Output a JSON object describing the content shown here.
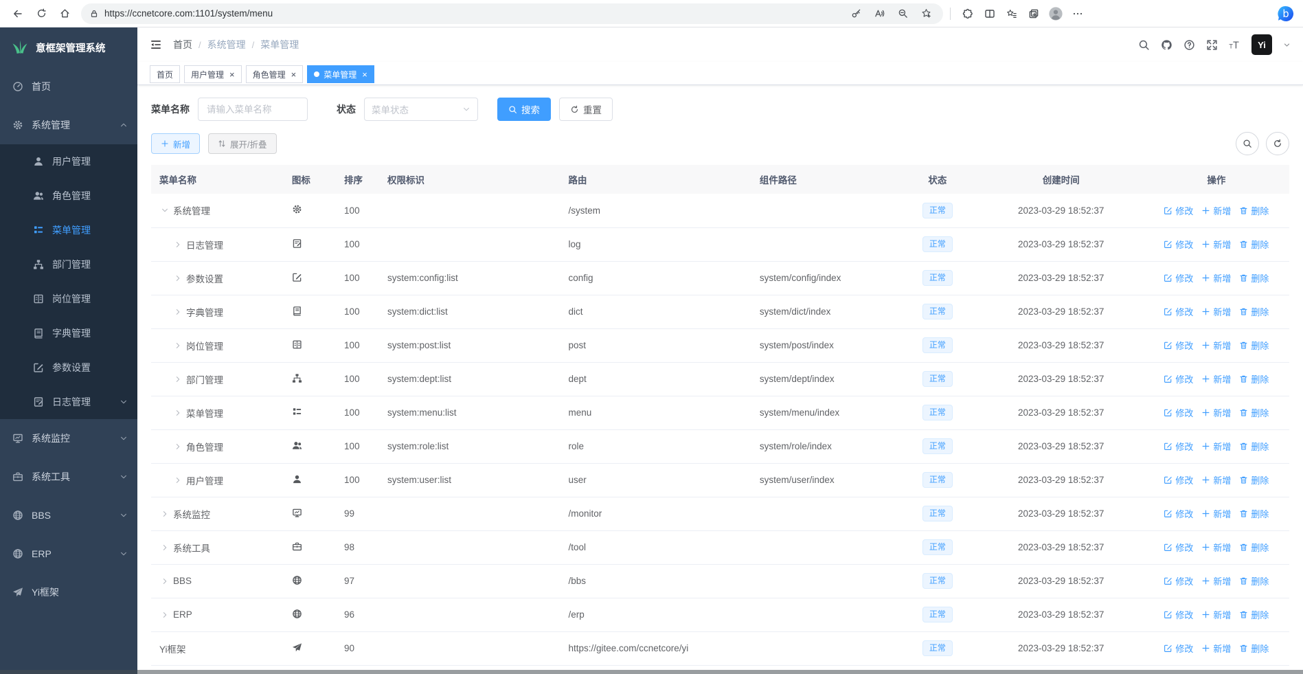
{
  "browser": {
    "url": "https://ccnetcore.com:1101/system/menu",
    "left_icons": [
      "back",
      "refresh",
      "home"
    ],
    "pill_icons": [
      "key",
      "read-aloud",
      "zoom-out",
      "add-favorite"
    ],
    "right_icons": [
      "extensions",
      "split-screen",
      "favorites",
      "collections",
      "profile",
      "more"
    ],
    "corner_icon": "copilot"
  },
  "sidebar": {
    "logo_title": "意框架管理系统",
    "items": [
      {
        "label": "首页",
        "icon": "dashboard"
      },
      {
        "label": "系统管理",
        "icon": "gear",
        "arrow": "up",
        "children": [
          {
            "label": "用户管理",
            "icon": "user"
          },
          {
            "label": "角色管理",
            "icon": "users"
          },
          {
            "label": "菜单管理",
            "icon": "menu-list",
            "active": true
          },
          {
            "label": "部门管理",
            "icon": "org-tree"
          },
          {
            "label": "岗位管理",
            "icon": "id-card"
          },
          {
            "label": "字典管理",
            "icon": "book"
          },
          {
            "label": "参数设置",
            "icon": "pen-square"
          },
          {
            "label": "日志管理",
            "icon": "doc-edit",
            "arrow": "down"
          }
        ]
      },
      {
        "label": "系统监控",
        "icon": "monitor",
        "arrow": "down"
      },
      {
        "label": "系统工具",
        "icon": "briefcase",
        "arrow": "down"
      },
      {
        "label": "BBS",
        "icon": "globe",
        "arrow": "down"
      },
      {
        "label": "ERP",
        "icon": "globe",
        "arrow": "down"
      },
      {
        "label": "Yi框架",
        "icon": "send"
      }
    ]
  },
  "navbar": {
    "breadcrumb": [
      "首页",
      "系统管理",
      "菜单管理"
    ],
    "icons": [
      "search",
      "github",
      "question",
      "fullscreen",
      "font-size"
    ],
    "avatar_text": "Yi"
  },
  "tabs": [
    {
      "label": "首页",
      "closable": false,
      "active": false
    },
    {
      "label": "用户管理",
      "closable": true,
      "active": false
    },
    {
      "label": "角色管理",
      "closable": true,
      "active": false
    },
    {
      "label": "菜单管理",
      "closable": true,
      "active": true
    }
  ],
  "filters": {
    "name_label": "菜单名称",
    "name_placeholder": "请输入菜单名称",
    "status_label": "状态",
    "status_placeholder": "菜单状态",
    "search_label": "搜索",
    "reset_label": "重置"
  },
  "toolbar": {
    "add_label": "新增",
    "expand_label": "展开/折叠"
  },
  "table": {
    "columns": [
      {
        "label": "菜单名称",
        "align": "left"
      },
      {
        "label": "图标",
        "align": "left"
      },
      {
        "label": "排序",
        "align": "left"
      },
      {
        "label": "权限标识",
        "align": "left"
      },
      {
        "label": "路由",
        "align": "left"
      },
      {
        "label": "组件路径",
        "align": "left"
      },
      {
        "label": "状态",
        "align": "center"
      },
      {
        "label": "创建时间",
        "align": "center"
      },
      {
        "label": "操作",
        "align": "center"
      }
    ],
    "action_labels": {
      "edit": "修改",
      "add": "新增",
      "delete": "删除"
    },
    "rows": [
      {
        "name": "系统管理",
        "icon": "gear",
        "sort": "100",
        "perms": "",
        "route": "/system",
        "component": "",
        "status": "正常",
        "created": "2023-03-29 18:52:37",
        "depth": 0,
        "expand": "expanded"
      },
      {
        "name": "日志管理",
        "icon": "doc-edit",
        "sort": "100",
        "perms": "",
        "route": "log",
        "component": "",
        "status": "正常",
        "created": "2023-03-29 18:52:37",
        "depth": 1,
        "expand": "collapsed"
      },
      {
        "name": "参数设置",
        "icon": "pen-square",
        "sort": "100",
        "perms": "system:config:list",
        "route": "config",
        "component": "system/config/index",
        "status": "正常",
        "created": "2023-03-29 18:52:37",
        "depth": 1,
        "expand": "collapsed"
      },
      {
        "name": "字典管理",
        "icon": "book",
        "sort": "100",
        "perms": "system:dict:list",
        "route": "dict",
        "component": "system/dict/index",
        "status": "正常",
        "created": "2023-03-29 18:52:37",
        "depth": 1,
        "expand": "collapsed"
      },
      {
        "name": "岗位管理",
        "icon": "id-card",
        "sort": "100",
        "perms": "system:post:list",
        "route": "post",
        "component": "system/post/index",
        "status": "正常",
        "created": "2023-03-29 18:52:37",
        "depth": 1,
        "expand": "collapsed"
      },
      {
        "name": "部门管理",
        "icon": "org-tree",
        "sort": "100",
        "perms": "system:dept:list",
        "route": "dept",
        "component": "system/dept/index",
        "status": "正常",
        "created": "2023-03-29 18:52:37",
        "depth": 1,
        "expand": "collapsed"
      },
      {
        "name": "菜单管理",
        "icon": "menu-list",
        "sort": "100",
        "perms": "system:menu:list",
        "route": "menu",
        "component": "system/menu/index",
        "status": "正常",
        "created": "2023-03-29 18:52:37",
        "depth": 1,
        "expand": "collapsed"
      },
      {
        "name": "角色管理",
        "icon": "users",
        "sort": "100",
        "perms": "system:role:list",
        "route": "role",
        "component": "system/role/index",
        "status": "正常",
        "created": "2023-03-29 18:52:37",
        "depth": 1,
        "expand": "collapsed"
      },
      {
        "name": "用户管理",
        "icon": "user",
        "sort": "100",
        "perms": "system:user:list",
        "route": "user",
        "component": "system/user/index",
        "status": "正常",
        "created": "2023-03-29 18:52:37",
        "depth": 1,
        "expand": "collapsed"
      },
      {
        "name": "系统监控",
        "icon": "monitor",
        "sort": "99",
        "perms": "",
        "route": "/monitor",
        "component": "",
        "status": "正常",
        "created": "2023-03-29 18:52:37",
        "depth": 0,
        "expand": "collapsed"
      },
      {
        "name": "系统工具",
        "icon": "briefcase",
        "sort": "98",
        "perms": "",
        "route": "/tool",
        "component": "",
        "status": "正常",
        "created": "2023-03-29 18:52:37",
        "depth": 0,
        "expand": "collapsed"
      },
      {
        "name": "BBS",
        "icon": "globe",
        "sort": "97",
        "perms": "",
        "route": "/bbs",
        "component": "",
        "status": "正常",
        "created": "2023-03-29 18:52:37",
        "depth": 0,
        "expand": "collapsed"
      },
      {
        "name": "ERP",
        "icon": "globe",
        "sort": "96",
        "perms": "",
        "route": "/erp",
        "component": "",
        "status": "正常",
        "created": "2023-03-29 18:52:37",
        "depth": 0,
        "expand": "collapsed"
      },
      {
        "name": "Yi框架",
        "icon": "send",
        "sort": "90",
        "perms": "",
        "route": "https://gitee.com/ccnetcore/yi",
        "component": "",
        "status": "正常",
        "created": "2023-03-29 18:52:37",
        "depth": 0,
        "expand": "leaf"
      }
    ]
  },
  "colors": {
    "accent": "#409eff",
    "sidebar_bg": "#304156",
    "submenu_bg": "#1f2d3d",
    "tag_bg": "#ecf5ff",
    "tag_border": "#d9ecff",
    "table_header_bg": "#f8f8f9",
    "logo_green": "#49c08a"
  }
}
